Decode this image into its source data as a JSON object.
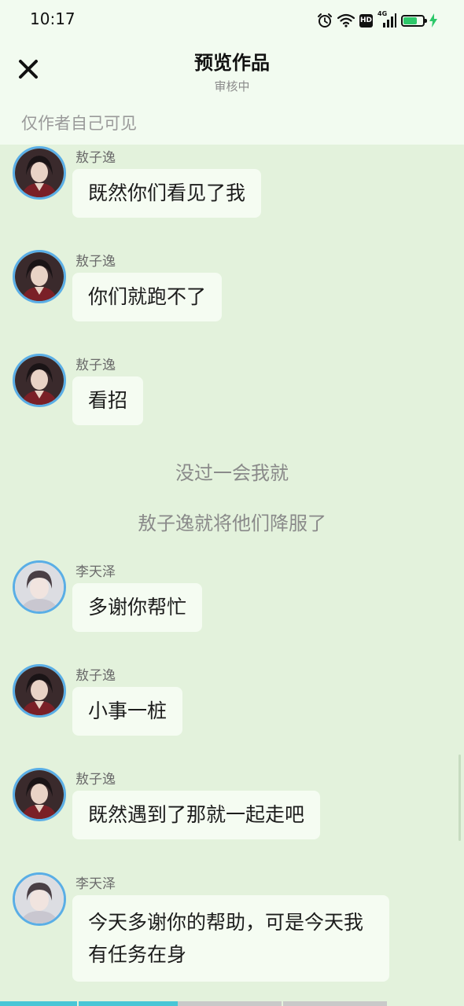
{
  "status_bar": {
    "time": "10:17",
    "network": "4G",
    "hd_label": "HD",
    "battery_level": 0.7
  },
  "header": {
    "close_icon": "close-icon",
    "title": "预览作品",
    "subtitle": "审核中",
    "visibility_note": "仅作者自己可见"
  },
  "characters": {
    "ao": {
      "name": "敖子逸",
      "avatar_icon": "avatar-ao-ziyi"
    },
    "li": {
      "name": "李天泽",
      "avatar_icon": "avatar-li-tianze"
    }
  },
  "chat": {
    "messages": [
      {
        "sender": "敖子逸",
        "text": "既然你们看见了我"
      },
      {
        "sender": "敖子逸",
        "text": "你们就跑不了"
      },
      {
        "sender": "敖子逸",
        "text": "看招"
      }
    ],
    "narration": [
      "没过一会我就",
      "敖子逸就将他们降服了"
    ],
    "messages_after": [
      {
        "sender": "李天泽",
        "text": "多谢你帮忙"
      },
      {
        "sender": "敖子逸",
        "text": "小事一桩"
      },
      {
        "sender": "敖子逸",
        "text": "既然遇到了那就一起走吧"
      },
      {
        "sender": "李天泽",
        "text": "今天多谢你的帮助，可是今天我有任务在身"
      }
    ]
  },
  "colors": {
    "background": "#e3f2dc",
    "header_bg": "#f2fbf0",
    "bubble_bg": "#f5fcf2",
    "avatar_border": "#5aaee6",
    "progress_active": "#48c6d6",
    "progress_inactive": "#c9c9c9"
  },
  "reading_progress": 0.46
}
